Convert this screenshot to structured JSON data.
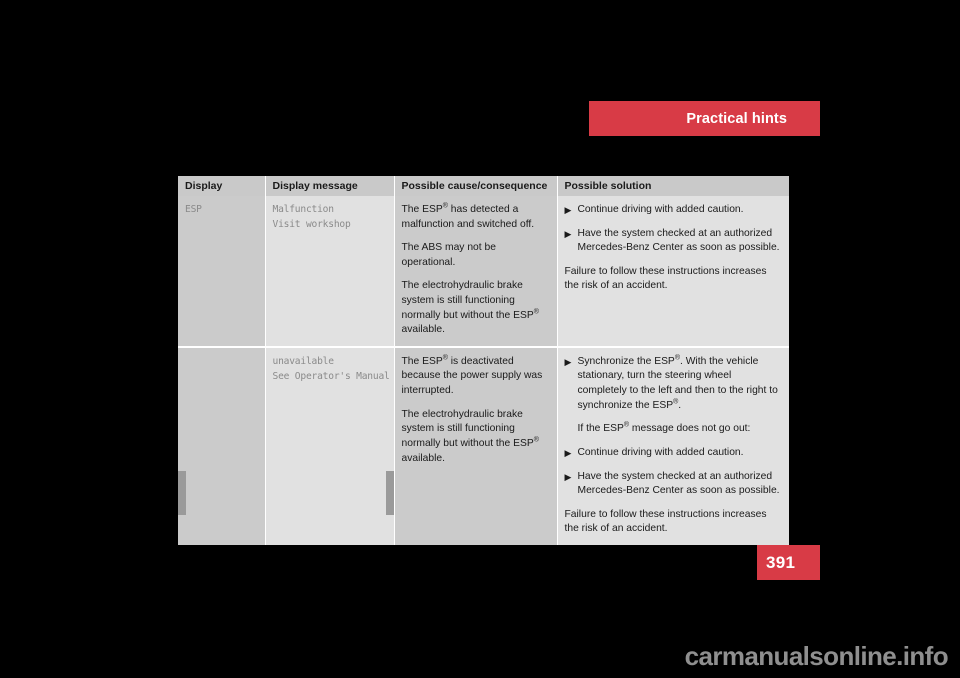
{
  "page": {
    "chapter_banner": "Practical hints",
    "page_number": "391",
    "watermark": "carmanualsonline.info",
    "accent_color": "#d83b46",
    "background_color": "#000000"
  },
  "table": {
    "headers": {
      "display": "Display",
      "message": "Display message",
      "cause": "Possible cause/consequence",
      "solution": "Possible solution"
    },
    "rows": [
      {
        "display": "ESP",
        "message_line1": "Malfunction",
        "message_line2": "Visit workshop",
        "cause": [
          "The ESP® has detected a malfunction and switched off.",
          "The ABS may not be operational.",
          "The electrohydraulic brake system is still functioning normally but without the ESP® available."
        ],
        "solution_bullets": [
          "Continue driving with added caution.",
          "Have the system checked at an authorized Mercedes-Benz Center as soon as possible."
        ],
        "solution_note": "Failure to follow these instructions increases the risk of an accident."
      },
      {
        "display": "",
        "message_line1": "unavailable",
        "message_line2": "See Operator's Manual",
        "cause": [
          "The ESP® is deactivated because the power supply was interrupted.",
          "The electrohydraulic brake system is still functioning normally but without the ESP® available."
        ],
        "solution_bullets": [
          "Synchronize the ESP®. With the vehicle stationary, turn the steering wheel completely to the left and then to the right to synchronize the ESP®.",
          "Continue driving with added caution.",
          "Have the system checked at an authorized Mercedes-Benz Center as soon as possible."
        ],
        "solution_mid_note": "If the ESP® message does not go out:",
        "solution_note": "Failure to follow these instructions increases the risk of an accident."
      }
    ],
    "bullet_glyph": "▶"
  }
}
